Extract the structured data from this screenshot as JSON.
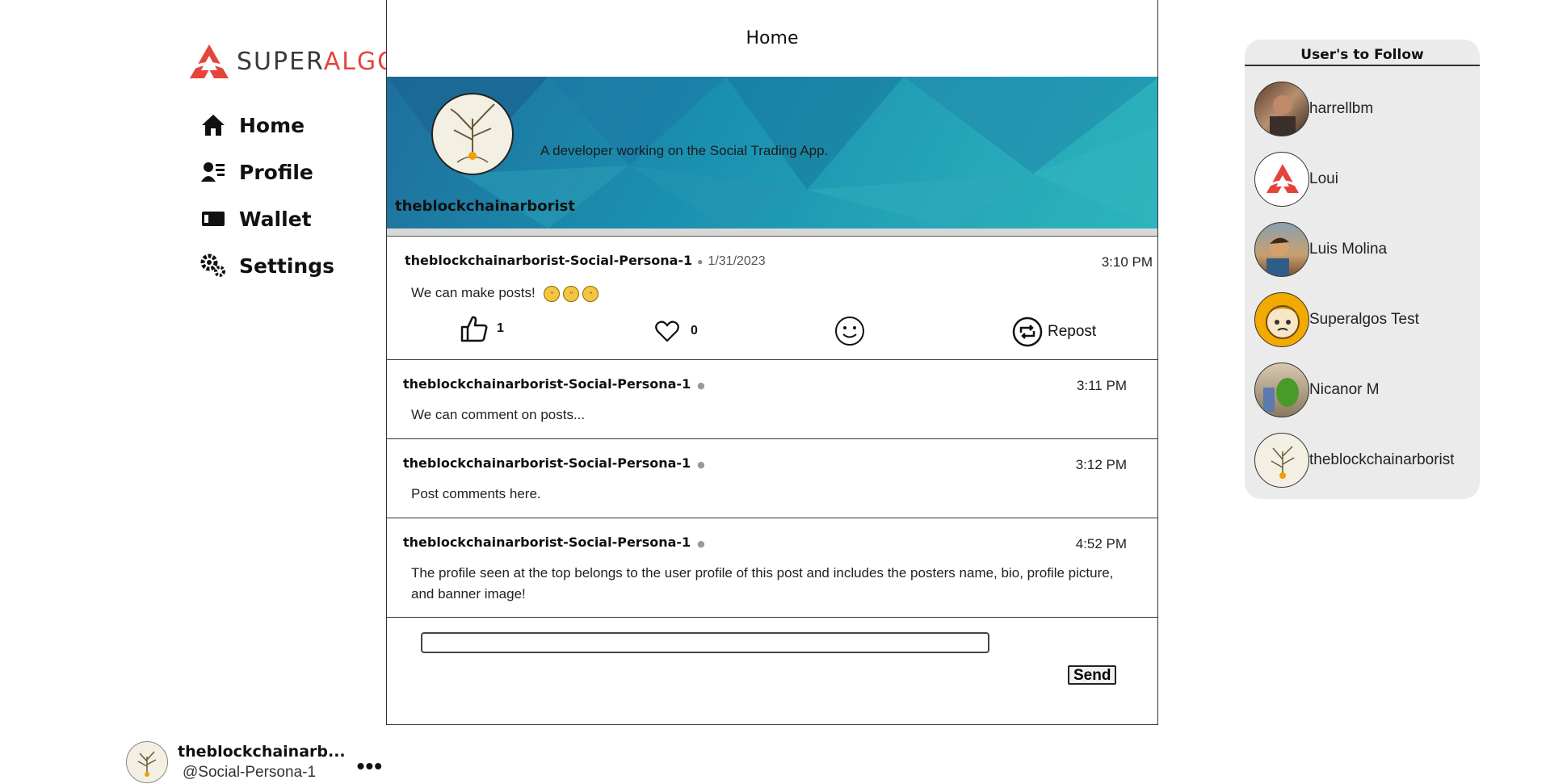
{
  "brand": {
    "name_part1": "SUPER",
    "name_part2": "ALGOS",
    "accent": "#e5443b"
  },
  "nav": {
    "items": [
      {
        "label": "Home",
        "icon": "home-icon"
      },
      {
        "label": "Profile",
        "icon": "profile-icon"
      },
      {
        "label": "Wallet",
        "icon": "wallet-icon"
      },
      {
        "label": "Settings",
        "icon": "gear-icon"
      }
    ]
  },
  "account": {
    "name": "theblockchainarb...",
    "handle": "@Social-Persona-1",
    "more": "•••"
  },
  "feed": {
    "title": "Home",
    "banner": {
      "name": "theblockchainarborist",
      "bio": "A developer working on the Social Trading App."
    },
    "post": {
      "author": "theblockchainarborist-Social-Persona-1",
      "date": "1/31/2023",
      "time": "3:10 PM",
      "text": "We can make posts!",
      "likes": "1",
      "hearts": "0",
      "repost_label": "Repost"
    },
    "comments": [
      {
        "author": "theblockchainarborist-Social-Persona-1",
        "time": "3:11 PM",
        "text": "We can comment on posts..."
      },
      {
        "author": "theblockchainarborist-Social-Persona-1",
        "time": "3:12 PM",
        "text": "Post comments here."
      },
      {
        "author": "theblockchainarborist-Social-Persona-1",
        "time": "4:52 PM",
        "text": "The profile seen at the top belongs to the user profile of this post and includes the posters name, bio, profile picture, and banner image!"
      }
    ],
    "compose": {
      "placeholder": "",
      "send_label": "Send"
    }
  },
  "follow": {
    "title": "User's to Follow",
    "users": [
      {
        "name": "harrellbm"
      },
      {
        "name": "Loui"
      },
      {
        "name": "Luis Molina"
      },
      {
        "name": "Superalgos Test"
      },
      {
        "name": "Nicanor M"
      },
      {
        "name": "theblockchainarborist"
      }
    ]
  }
}
